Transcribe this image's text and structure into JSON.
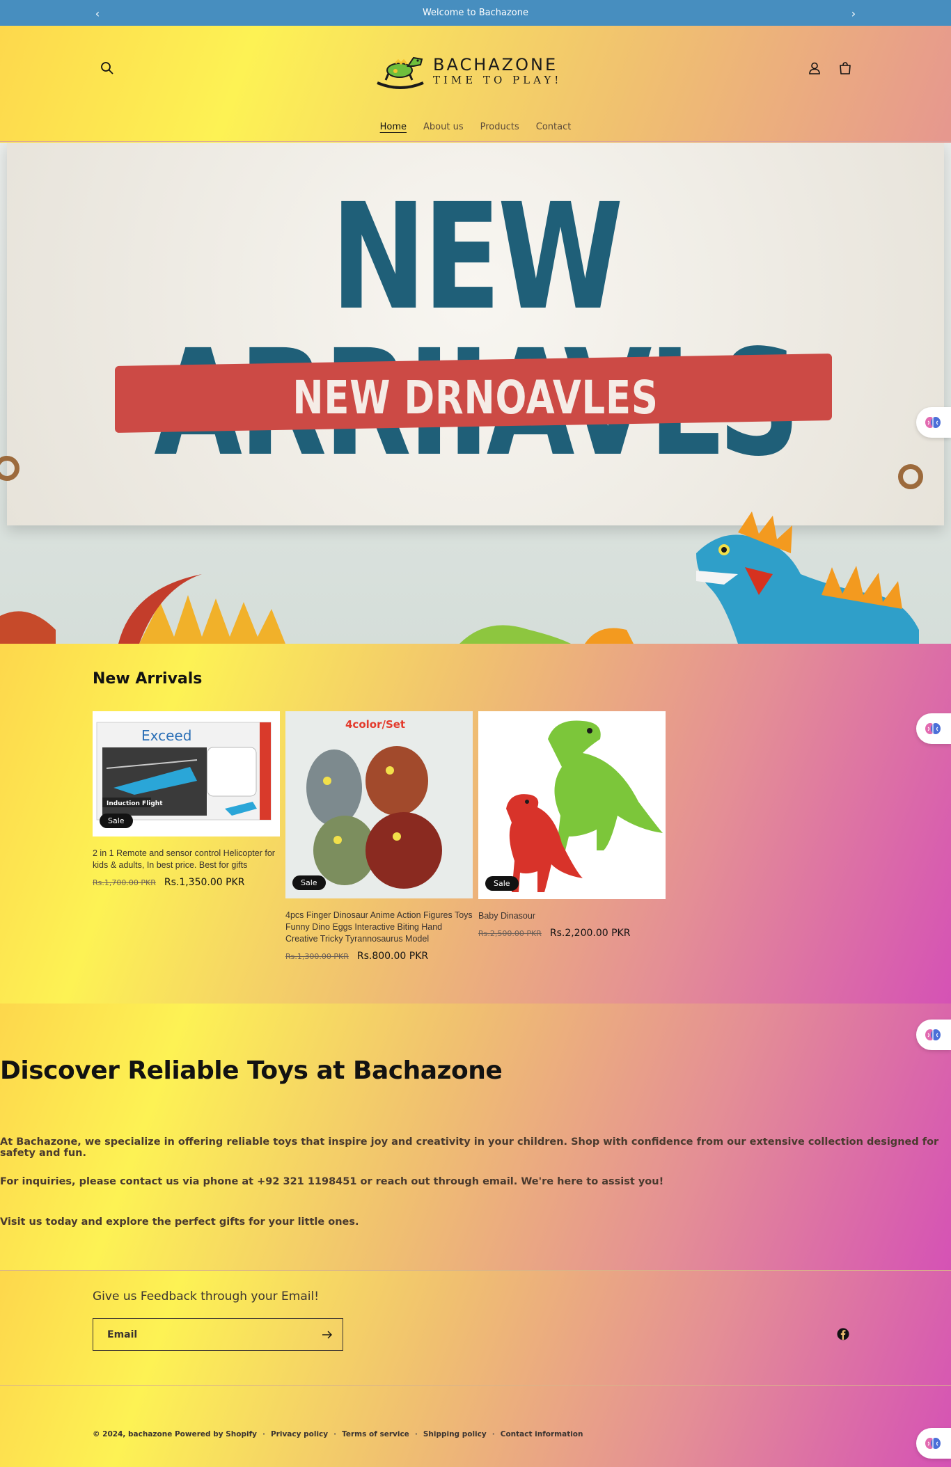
{
  "announcement": {
    "text": "Welcome to Bachazone",
    "prev_icon": "chevron-left",
    "next_icon": "chevron-right"
  },
  "header": {
    "logo_title": "BACHAZONE",
    "logo_tagline": "TIME TO PLAY!",
    "nav": [
      {
        "label": "Home",
        "active": true
      },
      {
        "label": "About us",
        "active": false
      },
      {
        "label": "Products",
        "active": false
      },
      {
        "label": "Contact",
        "active": false
      }
    ],
    "icons": [
      "search-icon",
      "account-icon",
      "cart-icon"
    ]
  },
  "hero": {
    "banner_title": "NEW ARRIIAVLS",
    "banner_subtitle": "NEW DRNOAVLES"
  },
  "arrivals": {
    "title": "New Arrivals",
    "products": [
      {
        "title": "2 in 1 Remote and sensor control Helicopter for kids & adults, In best price. Best for gifts",
        "old_price": "Rs.1,700.00 PKR",
        "price": "Rs.1,350.00 PKR",
        "badge": "Sale",
        "image_text": "Exceed",
        "image_subtext": "Induction Flight"
      },
      {
        "title": "4pcs Finger Dinosaur Anime Action Figures Toys Funny Dino Eggs Interactive Biting Hand Creative Tricky Tyrannosaurus Model",
        "old_price": "Rs.1,300.00 PKR",
        "price": "Rs.800.00 PKR",
        "badge": "Sale",
        "image_text": "4color/Set"
      },
      {
        "title": "Baby Dinasour",
        "old_price": "Rs.2,500.00 PKR",
        "price": "Rs.2,200.00 PKR",
        "badge": "Sale"
      }
    ]
  },
  "discover": {
    "heading": "Discover Reliable Toys at Bachazone",
    "p1": "At Bachazone, we specialize in offering reliable toys that inspire joy and creativity in your children. Shop with confidence from our extensive collection designed for safety and fun.",
    "p2": "For inquiries, please contact us via phone at +92 321 1198451 or reach out through email. We're here to assist you!",
    "p3": "Visit us today and explore the perfect gifts for your little ones."
  },
  "newsletter": {
    "title": "Give us Feedback through your Email!",
    "placeholder": "Email"
  },
  "footer": {
    "copyright": "© 2024, bachazone Powered by Shopify",
    "links": [
      "Privacy policy",
      "Terms of service",
      "Shipping policy",
      "Contact information"
    ]
  },
  "colors": {
    "announcement_bg": "#478ebf",
    "banner_blue": "#1f5f78",
    "banner_red": "#cc4a45",
    "sale_badge": "#121212"
  }
}
